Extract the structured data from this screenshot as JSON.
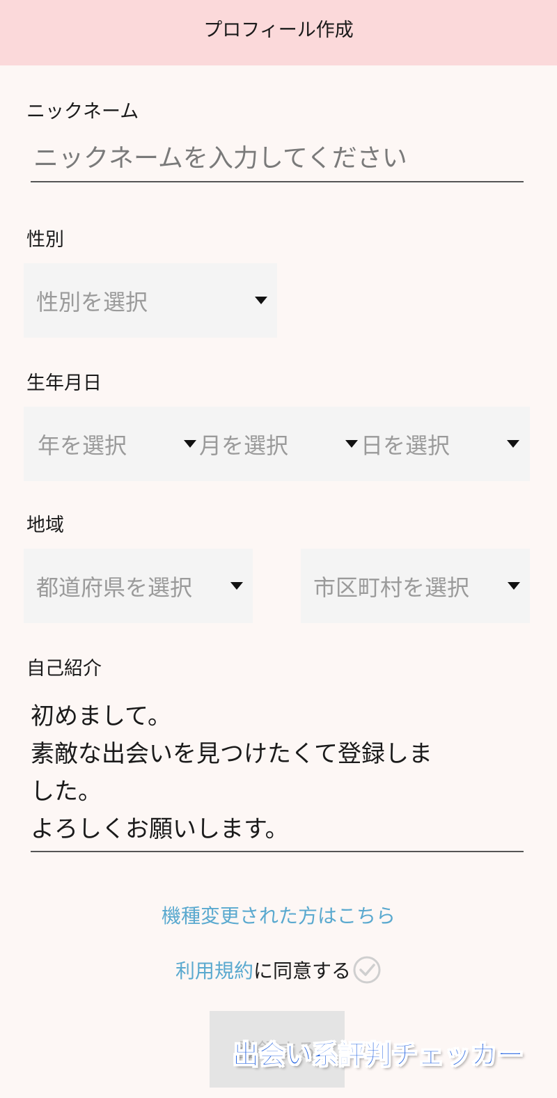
{
  "header": {
    "title": "プロフィール作成"
  },
  "nickname": {
    "label": "ニックネーム",
    "placeholder": "ニックネームを入力してください",
    "value": ""
  },
  "gender": {
    "label": "性別",
    "select_text": "性別を選択"
  },
  "birthdate": {
    "label": "生年月日",
    "year_text": "年を選択",
    "month_text": "月を選択",
    "day_text": "日を選択"
  },
  "region": {
    "label": "地域",
    "prefecture_text": "都道府県を選択",
    "city_text": "市区町村を選択"
  },
  "bio": {
    "label": "自己紹介",
    "lines": [
      "初めまして。",
      "素敵な出会いを見つけたくて登録しま",
      "した。",
      "よろしくお願いします。"
    ]
  },
  "device_change_link": "機種変更された方はこちら",
  "terms": {
    "link_text": "利用規約",
    "suffix_text": "に同意する",
    "checked": false
  },
  "submit": {
    "label": "登録する"
  },
  "watermark": {
    "text": "出会い系評判チェッカー"
  },
  "colors": {
    "header_bg": "#fbd9da",
    "page_bg": "#fdf7f5",
    "link": "#5aa9cf",
    "select_bg": "#f4f4f4",
    "watermark": "#1f5fe0"
  },
  "icons": {
    "select_caret": "caret-down-icon",
    "terms_check": "check-circle-icon"
  }
}
